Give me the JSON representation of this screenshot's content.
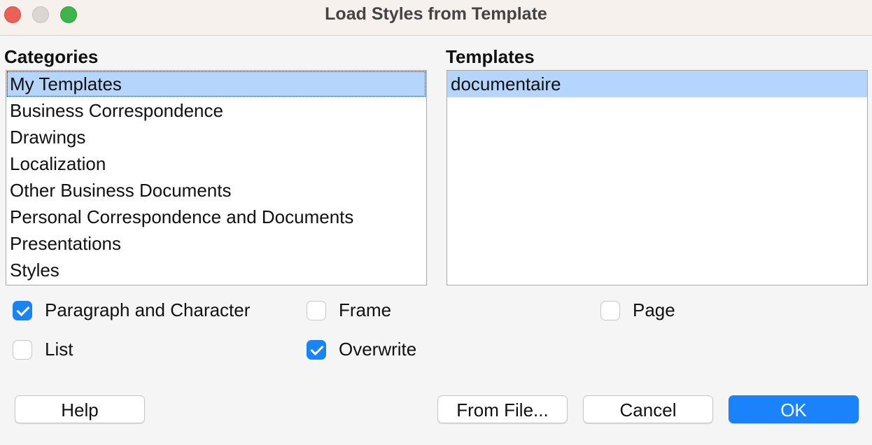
{
  "window": {
    "title": "Load Styles from Template"
  },
  "categories": {
    "label": "Categories",
    "items": [
      "My Templates",
      "Business Correspondence",
      "Drawings",
      "Localization",
      "Other Business Documents",
      "Personal Correspondence and Documents",
      "Presentations",
      "Styles"
    ],
    "selected_index": 0
  },
  "templates": {
    "label": "Templates",
    "items": [
      "documentaire"
    ],
    "selected_index": 0
  },
  "options": {
    "paragraph_and_character": {
      "label": "Paragraph and Character",
      "checked": true
    },
    "frame": {
      "label": "Frame",
      "checked": false
    },
    "page": {
      "label": "Page",
      "checked": false
    },
    "list": {
      "label": "List",
      "checked": false
    },
    "overwrite": {
      "label": "Overwrite",
      "checked": true
    }
  },
  "buttons": {
    "help": "Help",
    "from_file": "From File...",
    "cancel": "Cancel",
    "ok": "OK"
  },
  "colors": {
    "selection": "#b5d5fc",
    "accent": "#1a82fb",
    "close": "#ee5f57",
    "maximize": "#3fb549"
  }
}
